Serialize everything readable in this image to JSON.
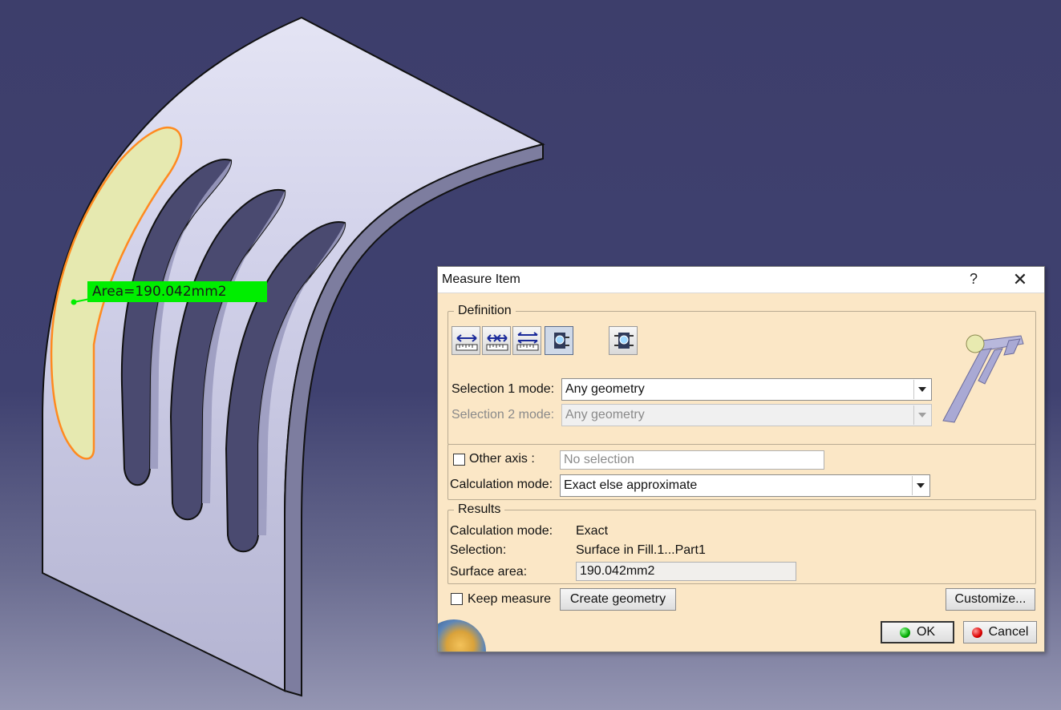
{
  "viewport": {
    "background_color": "#3f4170",
    "measure_label": "Area=190.042mm2",
    "label_color": "#00ee00",
    "highlight_color": "#ff8a1f"
  },
  "dialog": {
    "title": "Measure Item",
    "help_label": "?",
    "close_label": "✕",
    "definition": {
      "legend": "Definition",
      "tools": [
        "measure-between-icon",
        "measure-chain-icon",
        "measure-fan-icon",
        "measure-item-icon",
        "measure-thickness-icon"
      ],
      "selection1_label": "Selection 1 mode:",
      "selection1_value": "Any geometry",
      "selection2_label": "Selection 2 mode:",
      "selection2_value": "Any geometry",
      "other_axis_label": "Other axis :",
      "other_axis_placeholder": "No selection",
      "calc_mode_label": "Calculation mode:",
      "calc_mode_value": "Exact else approximate"
    },
    "results": {
      "legend": "Results",
      "calc_mode_label": "Calculation mode:",
      "calc_mode_value": "Exact",
      "selection_label": "Selection:",
      "selection_value": "Surface in Fill.1...Part1",
      "surface_area_label": "Surface area:",
      "surface_area_value": "190.042mm2"
    },
    "keep_measure_label": "Keep measure",
    "create_geometry_label": "Create geometry",
    "customize_label": "Customize...",
    "ok_label": "OK",
    "cancel_label": "Cancel",
    "dialog_bg": "#fbe7c6"
  }
}
